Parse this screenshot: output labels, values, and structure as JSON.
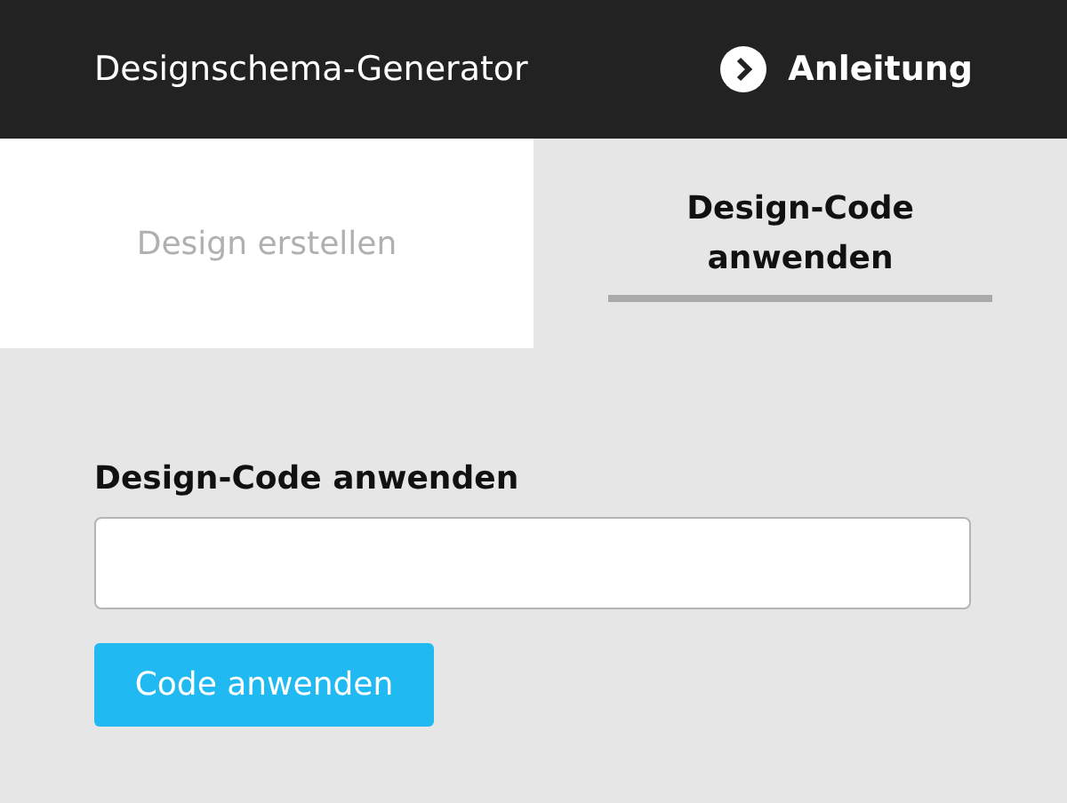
{
  "header": {
    "title": "Designschema-Generator",
    "guide_link": "Anleitung"
  },
  "tabs": [
    {
      "label": "Design erstellen",
      "selected": false
    },
    {
      "label": "Design-Code anwenden",
      "selected": true
    }
  ],
  "form": {
    "label": "Design-Code anwenden",
    "button": "Code anwenden"
  }
}
